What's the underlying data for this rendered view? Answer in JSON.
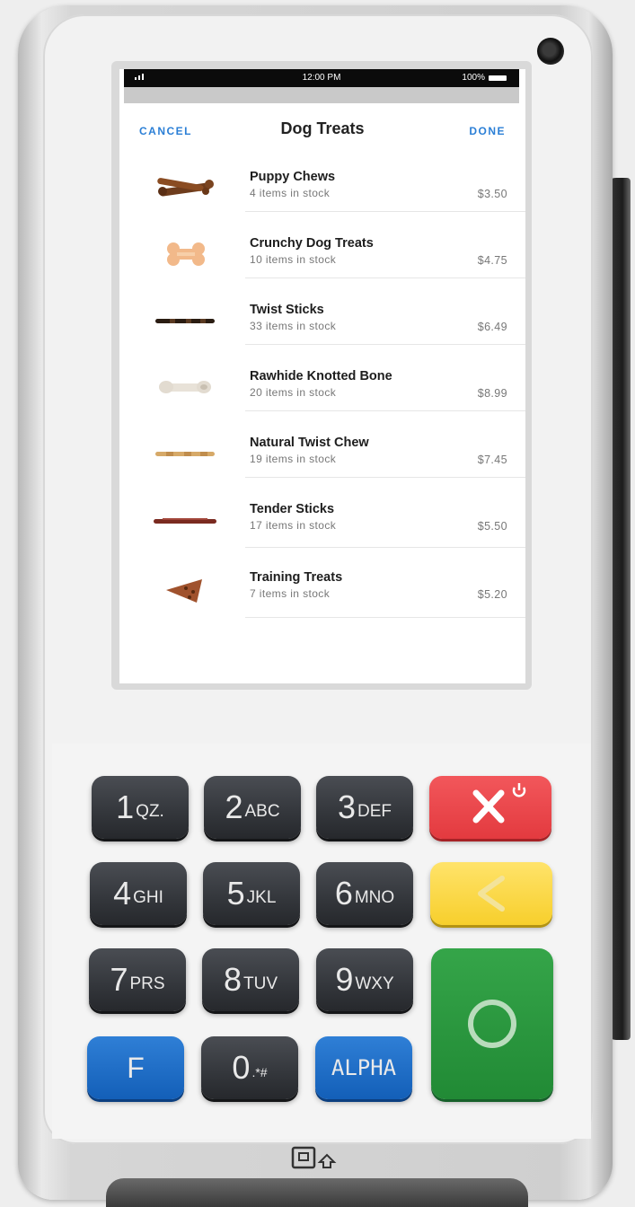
{
  "status_bar": {
    "time": "12:00 PM",
    "battery": "100%"
  },
  "nav": {
    "cancel_label": "CANCEL",
    "title": "Dog Treats",
    "done_label": "DONE"
  },
  "products": [
    {
      "name": "Puppy Chews",
      "stock": "4 items in stock",
      "price": "$3.50",
      "image": "puppy-chews-image"
    },
    {
      "name": "Crunchy Dog Treats",
      "stock": "10 items in stock",
      "price": "$4.75",
      "image": "bone-biscuit-image"
    },
    {
      "name": "Twist Sticks",
      "stock": "33 items in stock",
      "price": "$6.49",
      "image": "twist-stick-image"
    },
    {
      "name": "Rawhide Knotted Bone",
      "stock": "20 items in stock",
      "price": "$8.99",
      "image": "rawhide-bone-image"
    },
    {
      "name": "Natural Twist Chew",
      "stock": "19 items in stock",
      "price": "$7.45",
      "image": "natural-twist-image"
    },
    {
      "name": "Tender Sticks",
      "stock": "17 items in stock",
      "price": "$5.50",
      "image": "tender-stick-image"
    },
    {
      "name": "Training Treats",
      "stock": "7 items in stock",
      "price": "$5.20",
      "image": "training-treat-image"
    }
  ],
  "keypad": {
    "keys": [
      {
        "digit": "1",
        "letters": "QZ."
      },
      {
        "digit": "2",
        "letters": "ABC"
      },
      {
        "digit": "3",
        "letters": "DEF"
      },
      {
        "digit": "4",
        "letters": "GHI"
      },
      {
        "digit": "5",
        "letters": "JKL"
      },
      {
        "digit": "6",
        "letters": "MNO"
      },
      {
        "digit": "7",
        "letters": "PRS"
      },
      {
        "digit": "8",
        "letters": "TUV"
      },
      {
        "digit": "9",
        "letters": "WXY"
      },
      {
        "digit": "0",
        "letters": ".*#"
      }
    ],
    "f_label": "F",
    "alpha_label": "ALPHA",
    "cancel_key_icon": "x-power-icon",
    "clear_key_icon": "back-arrow-icon",
    "enter_key_icon": "circle-icon"
  },
  "colors": {
    "accent": "#2b7fd6",
    "key_dark": "#33363b",
    "key_blue": "#1f6fc8",
    "key_red": "#e8474b",
    "key_yellow": "#f9d94a",
    "key_green": "#2a963e"
  }
}
